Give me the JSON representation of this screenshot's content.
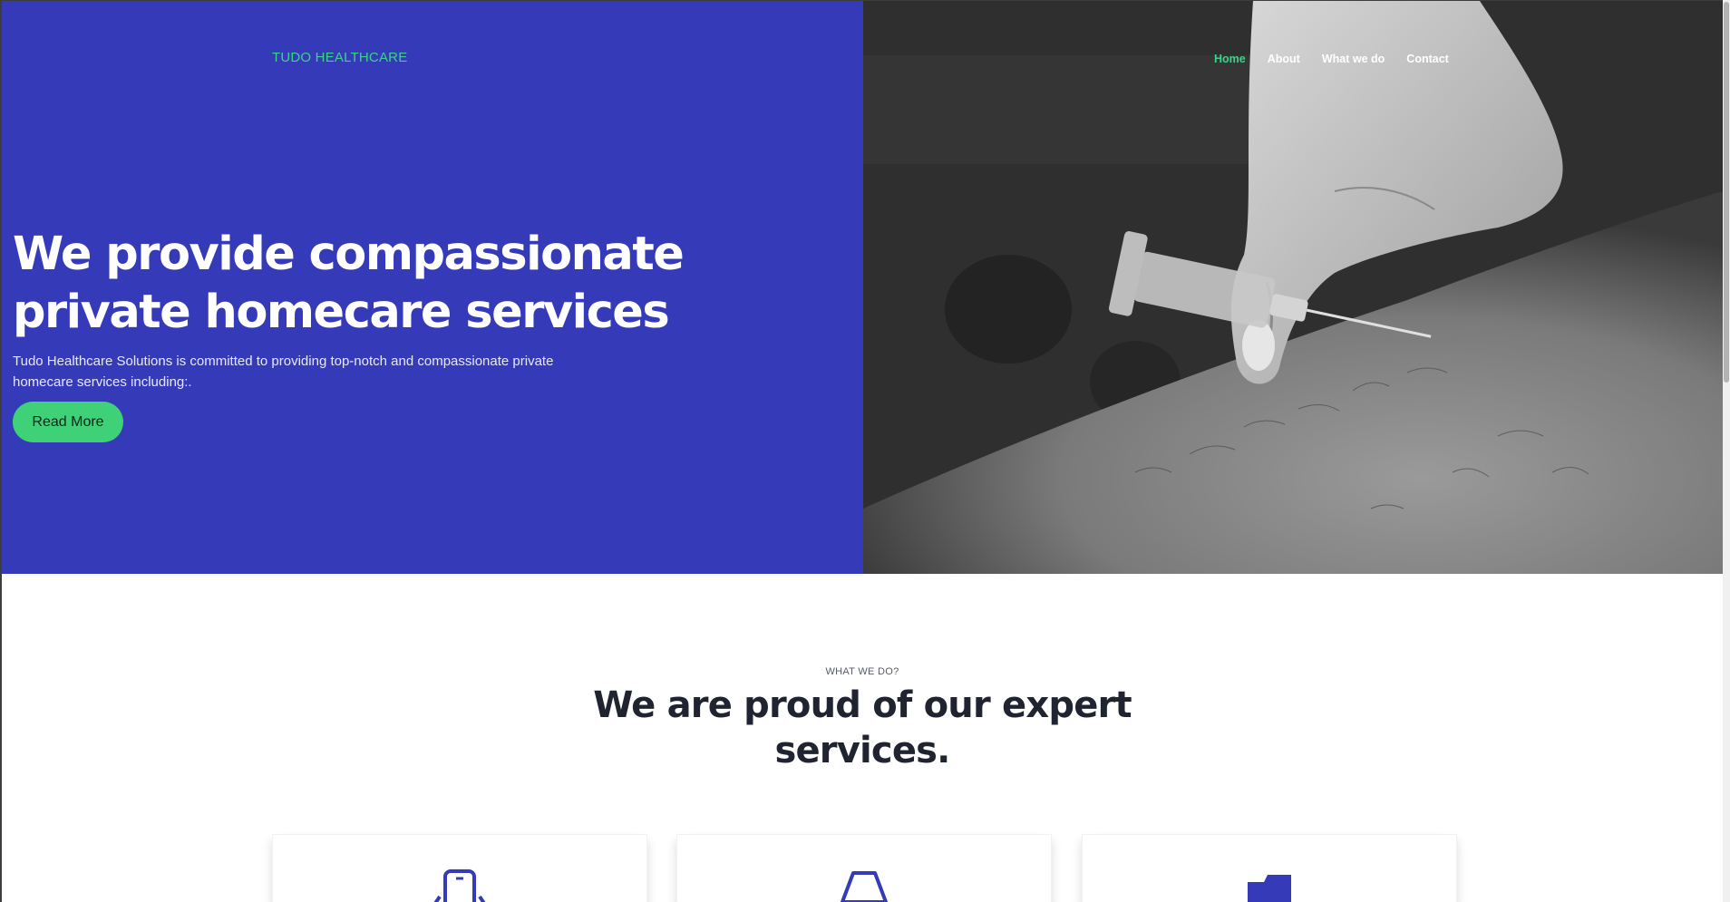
{
  "brand": "TUDO HEALTHCARE",
  "nav": {
    "items": [
      {
        "label": "Home",
        "active": true
      },
      {
        "label": "About",
        "active": false
      },
      {
        "label": "What we do",
        "active": false
      },
      {
        "label": "Contact",
        "active": false
      }
    ]
  },
  "hero": {
    "title_line1": "We provide compassionate",
    "title_line2": "private homecare services",
    "text_line1": "Tudo Healthcare Solutions is committed to providing top-notch and compassionate private",
    "text_line2": "homecare services including:.",
    "button_label": "Read More",
    "image_icon": "syringe-injection-photo"
  },
  "services": {
    "eyebrow": "WHAT WE DO?",
    "title_line1": "We are proud of our expert",
    "title_line2": "services.",
    "cards": [
      {
        "icon": "mobile-phone-icon"
      },
      {
        "icon": "lamp-icon"
      },
      {
        "icon": "folder-icon"
      }
    ]
  },
  "colors": {
    "hero_blue": "#353ab8",
    "accent_green": "#3ed18a",
    "button_green": "#3ed178",
    "heading_dark": "#1f2430"
  }
}
